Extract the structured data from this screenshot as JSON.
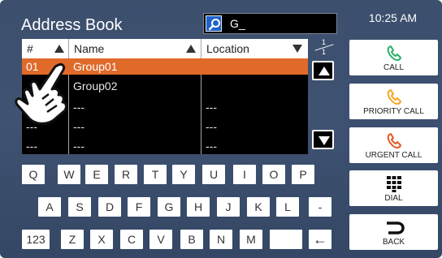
{
  "header": {
    "title": "Address Book",
    "search_value": "G_",
    "clock": "10:25 AM"
  },
  "table": {
    "columns": [
      "#",
      "Name",
      "Location"
    ],
    "rows": [
      {
        "num": "01",
        "name": "Group01",
        "location": "",
        "selected": true
      },
      {
        "num": "",
        "name": "Group02",
        "location": "",
        "selected": false
      },
      {
        "num": "",
        "name": "---",
        "location": "---",
        "selected": false
      },
      {
        "num": "---",
        "name": "---",
        "location": "---",
        "selected": false
      },
      {
        "num": "---",
        "name": "---",
        "location": "---",
        "selected": false
      }
    ],
    "page_current": "1",
    "page_total": "1"
  },
  "keyboard": {
    "row1": [
      "Q",
      "W",
      "E",
      "R",
      "T",
      "Y",
      "U",
      "I",
      "O",
      "P"
    ],
    "row2": [
      "A",
      "S",
      "D",
      "F",
      "G",
      "H",
      "J",
      "K",
      "L",
      "-"
    ],
    "row3": [
      "123",
      "Z",
      "X",
      "C",
      "V",
      "B",
      "N",
      "M",
      "",
      "←"
    ]
  },
  "side_buttons": {
    "call": "CALL",
    "priority_call": "PRIORITY CALL",
    "urgent_call": "URGENT CALL",
    "dial": "DIAL",
    "back": "BACK"
  },
  "colors": {
    "call": "#2bb26a",
    "priority": "#f5a623",
    "urgent": "#e25a2a",
    "selected_row": "#e06a2a",
    "panel": "#3d5071"
  }
}
